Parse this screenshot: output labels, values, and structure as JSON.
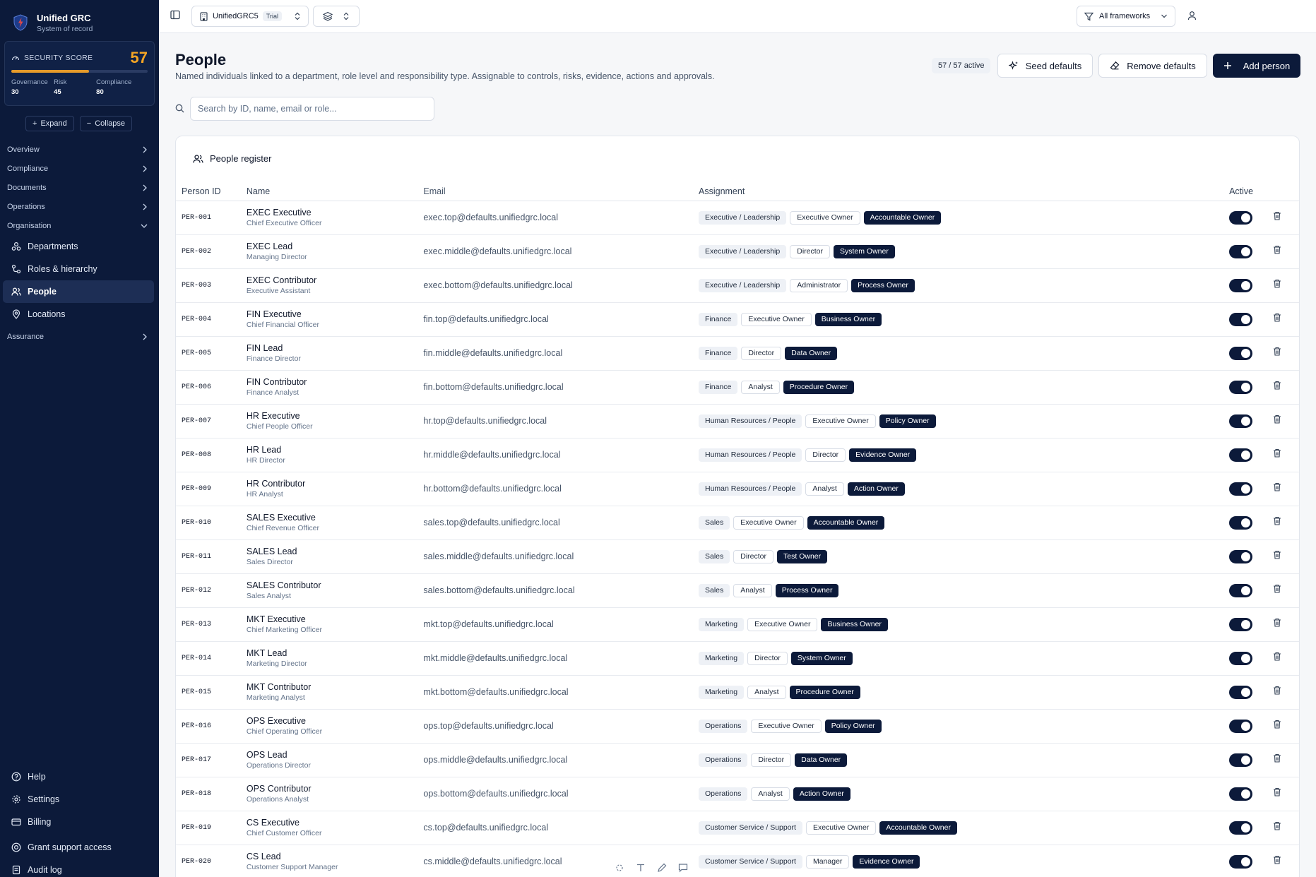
{
  "brand": {
    "title": "Unified GRC",
    "subtitle": "System of record"
  },
  "security_score": {
    "label": "SECURITY SCORE",
    "value": "57",
    "fill_percent": 57,
    "governance_label": "Governance",
    "governance_value": "30",
    "risk_label": "Risk",
    "risk_value": "45",
    "compliance_label": "Compliance",
    "compliance_value": "80"
  },
  "sidebar": {
    "expand_label": "Expand",
    "collapse_label": "Collapse",
    "groups": {
      "overview": "Overview",
      "compliance": "Compliance",
      "documents": "Documents",
      "operations": "Operations",
      "organisation": "Organisation",
      "assurance": "Assurance"
    },
    "org_items": {
      "departments": "Departments",
      "roles": "Roles & hierarchy",
      "people": "People",
      "locations": "Locations"
    },
    "bottom": {
      "help": "Help",
      "settings": "Settings",
      "billing": "Billing",
      "grant": "Grant support access",
      "audit": "Audit log"
    }
  },
  "topbar": {
    "workspace": "UnifiedGRC5",
    "trial_badge": "Trial",
    "frameworks": "All frameworks"
  },
  "page": {
    "title": "People",
    "subtitle": "Named individuals linked to a department, role level and responsibility type. Assignable to controls, risks, evidence, actions and approvals.",
    "active_count": "57 / 57 active",
    "seed_label": "Seed defaults",
    "remove_label": "Remove defaults",
    "add_label": "Add person",
    "search_placeholder": "Search by ID, name, email or role..."
  },
  "register": {
    "title": "People register",
    "columns": {
      "id": "Person ID",
      "name": "Name",
      "email": "Email",
      "assignment": "Assignment",
      "active": "Active"
    },
    "rows": [
      {
        "id": "PER-001",
        "name": "EXEC Executive",
        "title": "Chief Executive Officer",
        "email": "exec.top@defaults.unifiedgrc.local",
        "dept": "Executive / Leadership",
        "level": "Executive Owner",
        "owner": "Accountable Owner",
        "active": true
      },
      {
        "id": "PER-002",
        "name": "EXEC Lead",
        "title": "Managing Director",
        "email": "exec.middle@defaults.unifiedgrc.local",
        "dept": "Executive / Leadership",
        "level": "Director",
        "owner": "System Owner",
        "active": true
      },
      {
        "id": "PER-003",
        "name": "EXEC Contributor",
        "title": "Executive Assistant",
        "email": "exec.bottom@defaults.unifiedgrc.local",
        "dept": "Executive / Leadership",
        "level": "Administrator",
        "owner": "Process Owner",
        "active": true
      },
      {
        "id": "PER-004",
        "name": "FIN Executive",
        "title": "Chief Financial Officer",
        "email": "fin.top@defaults.unifiedgrc.local",
        "dept": "Finance",
        "level": "Executive Owner",
        "owner": "Business Owner",
        "active": true
      },
      {
        "id": "PER-005",
        "name": "FIN Lead",
        "title": "Finance Director",
        "email": "fin.middle@defaults.unifiedgrc.local",
        "dept": "Finance",
        "level": "Director",
        "owner": "Data Owner",
        "active": true
      },
      {
        "id": "PER-006",
        "name": "FIN Contributor",
        "title": "Finance Analyst",
        "email": "fin.bottom@defaults.unifiedgrc.local",
        "dept": "Finance",
        "level": "Analyst",
        "owner": "Procedure Owner",
        "active": true
      },
      {
        "id": "PER-007",
        "name": "HR Executive",
        "title": "Chief People Officer",
        "email": "hr.top@defaults.unifiedgrc.local",
        "dept": "Human Resources / People",
        "level": "Executive Owner",
        "owner": "Policy Owner",
        "active": true
      },
      {
        "id": "PER-008",
        "name": "HR Lead",
        "title": "HR Director",
        "email": "hr.middle@defaults.unifiedgrc.local",
        "dept": "Human Resources / People",
        "level": "Director",
        "owner": "Evidence Owner",
        "active": true
      },
      {
        "id": "PER-009",
        "name": "HR Contributor",
        "title": "HR Analyst",
        "email": "hr.bottom@defaults.unifiedgrc.local",
        "dept": "Human Resources / People",
        "level": "Analyst",
        "owner": "Action Owner",
        "active": true
      },
      {
        "id": "PER-010",
        "name": "SALES Executive",
        "title": "Chief Revenue Officer",
        "email": "sales.top@defaults.unifiedgrc.local",
        "dept": "Sales",
        "level": "Executive Owner",
        "owner": "Accountable Owner",
        "active": true
      },
      {
        "id": "PER-011",
        "name": "SALES Lead",
        "title": "Sales Director",
        "email": "sales.middle@defaults.unifiedgrc.local",
        "dept": "Sales",
        "level": "Director",
        "owner": "Test Owner",
        "active": true
      },
      {
        "id": "PER-012",
        "name": "SALES Contributor",
        "title": "Sales Analyst",
        "email": "sales.bottom@defaults.unifiedgrc.local",
        "dept": "Sales",
        "level": "Analyst",
        "owner": "Process Owner",
        "active": true
      },
      {
        "id": "PER-013",
        "name": "MKT Executive",
        "title": "Chief Marketing Officer",
        "email": "mkt.top@defaults.unifiedgrc.local",
        "dept": "Marketing",
        "level": "Executive Owner",
        "owner": "Business Owner",
        "active": true
      },
      {
        "id": "PER-014",
        "name": "MKT Lead",
        "title": "Marketing Director",
        "email": "mkt.middle@defaults.unifiedgrc.local",
        "dept": "Marketing",
        "level": "Director",
        "owner": "System Owner",
        "active": true
      },
      {
        "id": "PER-015",
        "name": "MKT Contributor",
        "title": "Marketing Analyst",
        "email": "mkt.bottom@defaults.unifiedgrc.local",
        "dept": "Marketing",
        "level": "Analyst",
        "owner": "Procedure Owner",
        "active": true
      },
      {
        "id": "PER-016",
        "name": "OPS Executive",
        "title": "Chief Operating Officer",
        "email": "ops.top@defaults.unifiedgrc.local",
        "dept": "Operations",
        "level": "Executive Owner",
        "owner": "Policy Owner",
        "active": true
      },
      {
        "id": "PER-017",
        "name": "OPS Lead",
        "title": "Operations Director",
        "email": "ops.middle@defaults.unifiedgrc.local",
        "dept": "Operations",
        "level": "Director",
        "owner": "Data Owner",
        "active": true
      },
      {
        "id": "PER-018",
        "name": "OPS Contributor",
        "title": "Operations Analyst",
        "email": "ops.bottom@defaults.unifiedgrc.local",
        "dept": "Operations",
        "level": "Analyst",
        "owner": "Action Owner",
        "active": true
      },
      {
        "id": "PER-019",
        "name": "CS Executive",
        "title": "Chief Customer Officer",
        "email": "cs.top@defaults.unifiedgrc.local",
        "dept": "Customer Service / Support",
        "level": "Executive Owner",
        "owner": "Accountable Owner",
        "active": true
      },
      {
        "id": "PER-020",
        "name": "CS Lead",
        "title": "Customer Support Manager",
        "email": "cs.middle@defaults.unifiedgrc.local",
        "dept": "Customer Service / Support",
        "level": "Manager",
        "owner": "Evidence Owner",
        "active": true
      }
    ]
  },
  "colors": {
    "sidebar_bg": "#0c1a3a",
    "accent_orange": "#f5a524",
    "primary_dark": "#0c1a3a"
  }
}
